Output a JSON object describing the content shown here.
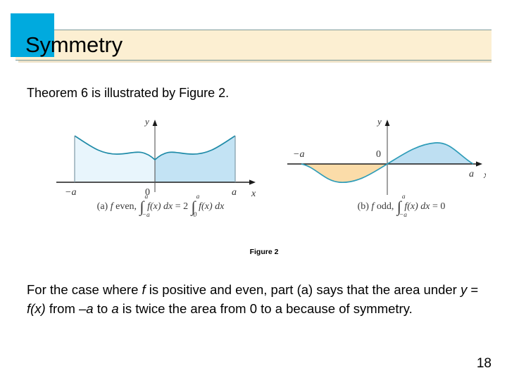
{
  "slide": {
    "title": "Symmetry",
    "page_number": "18",
    "accent_square_color": "#00AADE",
    "banner_color": "#FCEFD2",
    "banner_rule_color": "#7C9A9A"
  },
  "intro": {
    "text": "Theorem 6 is illustrated by Figure 2."
  },
  "figure": {
    "label": "Figure 2",
    "panels": [
      {
        "id": "a",
        "caption_prefix": "(a)",
        "caption_fn": "f",
        "caption_word": "even,",
        "integral_1_upper": "a",
        "integral_1_lower": "−a",
        "integrand_1": "f(x) dx",
        "equals": "=",
        "coefficient": "2",
        "integral_2_upper": "a",
        "integral_2_lower": "0",
        "integrand_2": "f(x) dx",
        "axis_x_label": "x",
        "axis_y_label": "y",
        "tick_left": "−a",
        "tick_origin": "0",
        "tick_right": "a",
        "fill_left_color": "#E8F5FC",
        "fill_right_color": "#C3E3F4",
        "curve_color": "#1F8BA8"
      },
      {
        "id": "b",
        "caption_prefix": "(b)",
        "caption_fn": "f",
        "caption_word": "odd,",
        "integral_1_upper": "a",
        "integral_1_lower": "−a",
        "integrand_1": "f(x) dx",
        "equals": "=",
        "result": "0",
        "axis_x_label": "x",
        "axis_y_label": "y",
        "tick_left": "−a",
        "tick_origin": "0",
        "tick_right": "a",
        "fill_negative_color": "#FBDCA9",
        "fill_positive_color": "#BEDFF2",
        "curve_color": "#2E9CB8"
      }
    ]
  },
  "closing": {
    "line1_a": "For the case where ",
    "line1_f": "f",
    "line1_b": " is positive and even, part (a) says that",
    "line2_a": "the area under ",
    "line2_y": "y",
    "line2_b": " = ",
    "line2_fx": "f(x)",
    "line2_c": " from –",
    "line2_a1": "a",
    "line2_d": " to ",
    "line2_a2": "a",
    "line2_e": " is twice the area from",
    "line3": "0 to a because of symmetry."
  }
}
